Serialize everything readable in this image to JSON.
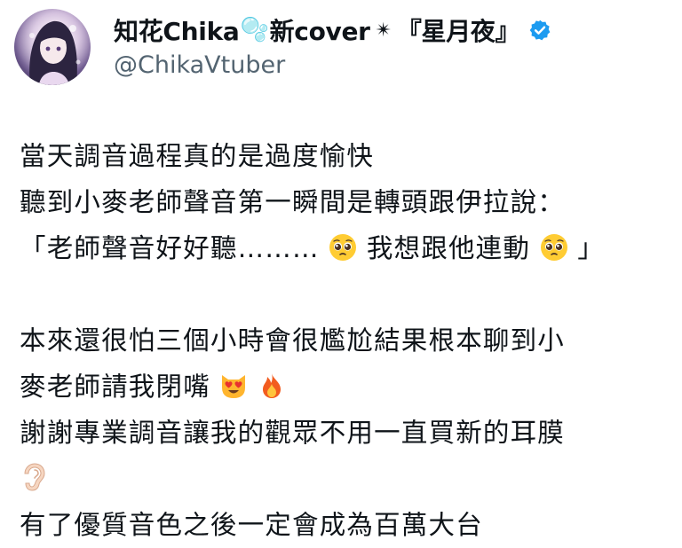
{
  "author": {
    "name_prefix": "知花Chika",
    "name_emoji": "🫧",
    "name_middle": "新cover",
    "name_star": "✴",
    "name_suffix": "『星月夜』",
    "handle": "@ChikaVtuber",
    "verified_color": "#1d9bf0",
    "verified_icon": "verified-badge-icon"
  },
  "tweet": {
    "line1": "當天調音過程真的是過度愉快",
    "line2": "聽到小麥老師聲音第一瞬間是轉頭跟伊拉說：",
    "line3_a": "「老師聲音好好聽………",
    "line3_b": "我想跟他連動",
    "line3_c": "」",
    "line4": "本來還很怕三個小時會很尷尬結果根本聊到小",
    "line5": "麥老師請我閉嘴",
    "line6": "謝謝專業調音讓我的觀眾不用一直買新的耳膜",
    "line8": "有了優質音色之後一定會成為百萬大台",
    "emojis": [
      "pleading-face",
      "pleading-face",
      "heart-eyes-cat",
      "fire",
      "ear"
    ]
  },
  "colors": {
    "text": "#0f1419",
    "handle": "#536471"
  }
}
